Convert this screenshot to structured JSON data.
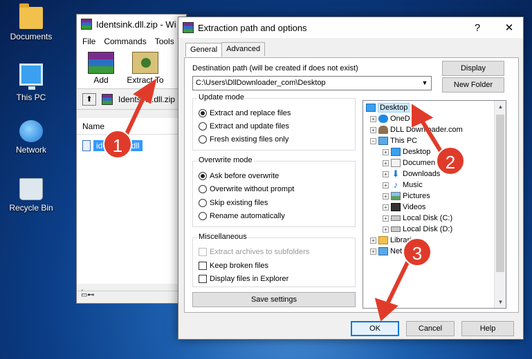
{
  "desktop": {
    "icons": [
      {
        "label": "Documents",
        "icon": "documents-folder-icon"
      },
      {
        "label": "This PC",
        "icon": "this-pc-icon"
      },
      {
        "label": "Network",
        "icon": "network-icon"
      },
      {
        "label": "Recycle Bin",
        "icon": "recycle-bin-icon"
      }
    ]
  },
  "winrar": {
    "title": "Identsink.dll.zip - Wi",
    "menu": [
      "File",
      "Commands",
      "Tools"
    ],
    "toolbar": {
      "add": "Add",
      "extract_to": "Extract To",
      "partial": "T"
    },
    "path": "Identsink.dll.zip",
    "column_name": "Name",
    "file_name": "identsink.dll"
  },
  "dialog": {
    "title": "Extraction path and options",
    "help_glyph": "?",
    "close_glyph": "✕",
    "tabs": [
      "General",
      "Advanced"
    ],
    "destination_label": "Destination path (will be created if does not exist)",
    "destination_value": "C:\\Users\\DllDownloader_com\\Desktop",
    "display_button": "Display",
    "new_folder_button": "New Folder",
    "update_mode": {
      "title": "Update mode",
      "options": [
        "Extract and replace files",
        "Extract and update files",
        "Fresh existing files only"
      ],
      "selected": 0
    },
    "overwrite_mode": {
      "title": "Overwrite mode",
      "options": [
        "Ask before overwrite",
        "Overwrite without prompt",
        "Skip existing files",
        "Rename automatically"
      ],
      "selected": 0
    },
    "misc": {
      "title": "Miscellaneous",
      "options": [
        "Extract archives to subfolders",
        "Keep broken files",
        "Display files in Explorer"
      ]
    },
    "save_settings": "Save settings",
    "tree": [
      {
        "label": "Desktop",
        "level": 0,
        "selected": true
      },
      {
        "label": "OneD",
        "level": 1
      },
      {
        "label": "DLL Downloader.com",
        "level": 1
      },
      {
        "label": "This PC",
        "level": 1
      },
      {
        "label": "Desktop",
        "level": 2
      },
      {
        "label": "Documen",
        "level": 2
      },
      {
        "label": "Downloads",
        "level": 2
      },
      {
        "label": "Music",
        "level": 2
      },
      {
        "label": "Pictures",
        "level": 2
      },
      {
        "label": "Videos",
        "level": 2
      },
      {
        "label": "Local Disk (C:)",
        "level": 2
      },
      {
        "label": "Local Disk (D:)",
        "level": 2
      },
      {
        "label": "Libraries",
        "level": 1
      },
      {
        "label": "Net",
        "level": 1
      }
    ],
    "ok": "OK",
    "cancel": "Cancel",
    "help": "Help"
  },
  "annotations": {
    "markers": [
      "1",
      "2",
      "3"
    ],
    "color": "#e03b2a"
  }
}
